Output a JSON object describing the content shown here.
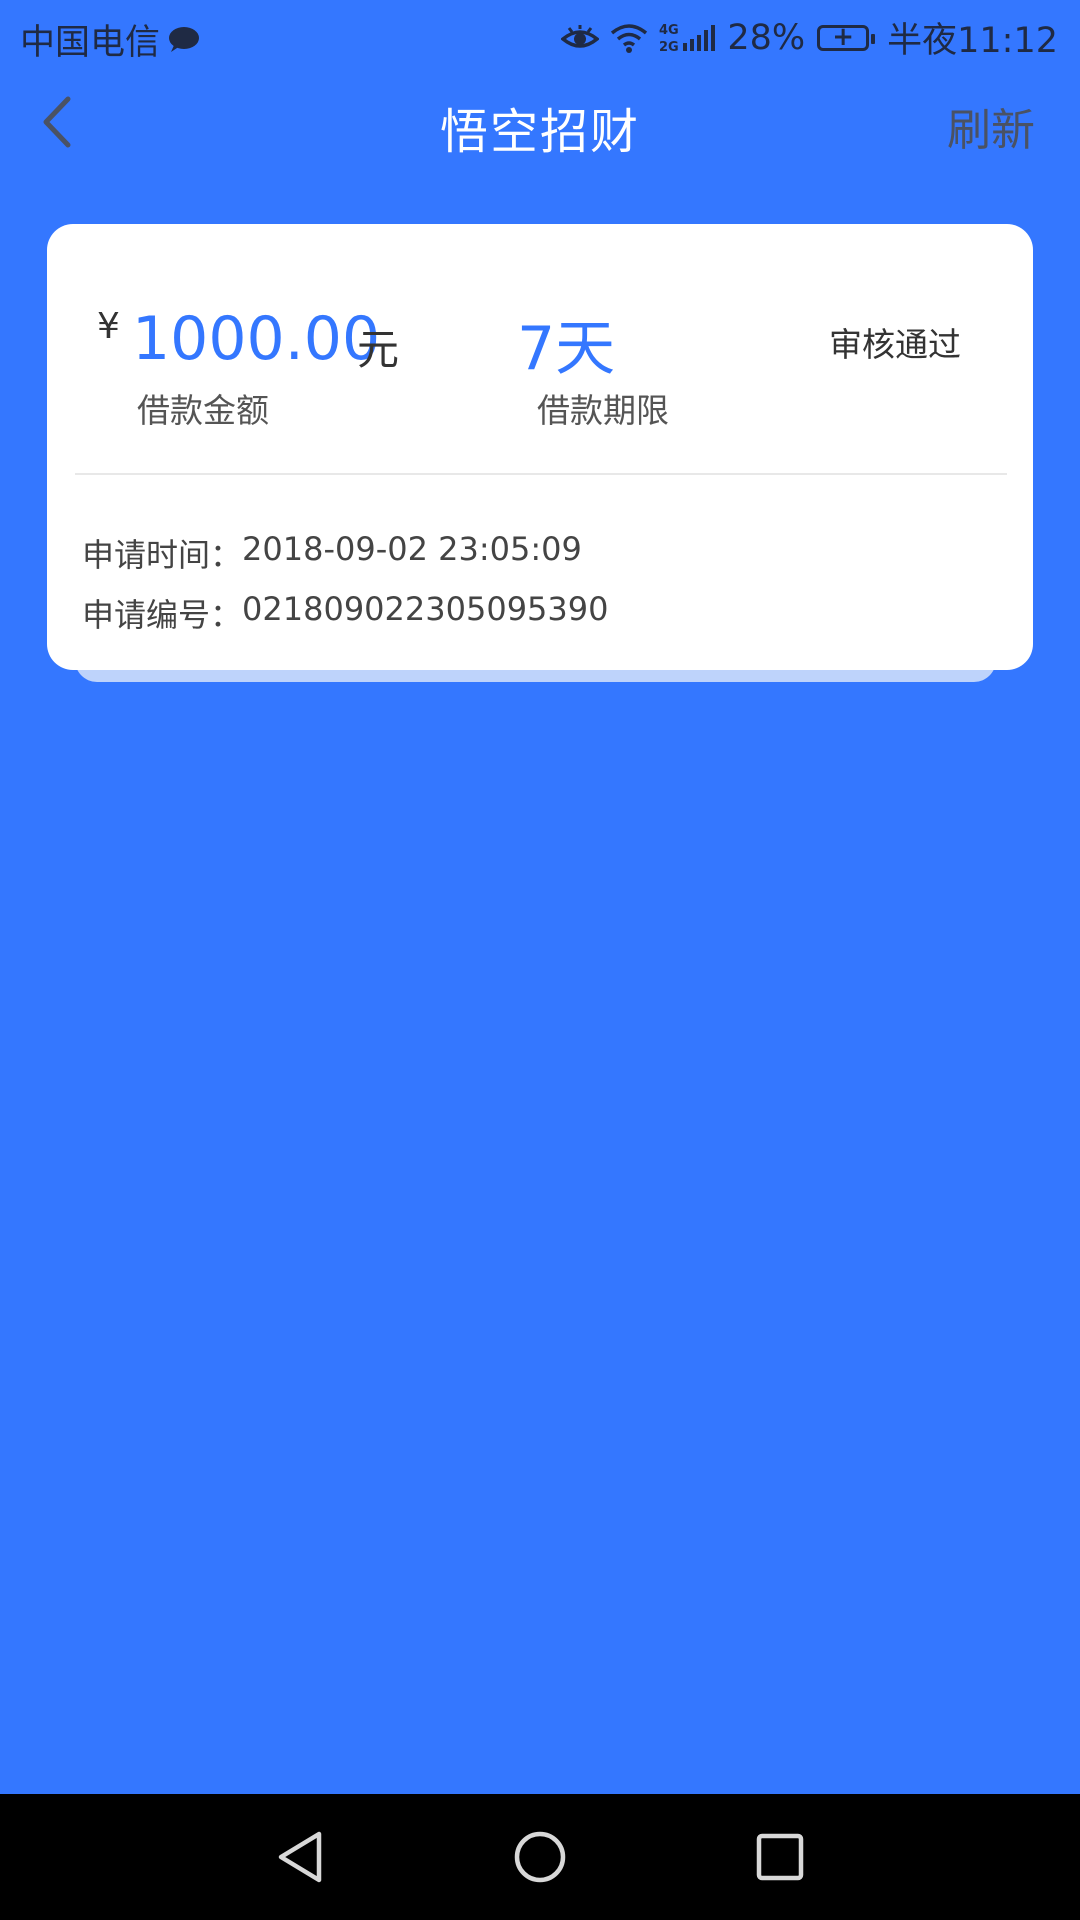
{
  "status_bar": {
    "carrier": "中国电信",
    "network": "4G 2G",
    "battery_percent": "28%",
    "time": "半夜11:12",
    "icons": [
      "chat-icon",
      "eye-icon",
      "wifi-icon",
      "signal-icon",
      "battery-icon"
    ]
  },
  "header": {
    "title": "悟空招财",
    "refresh_label": "刷新",
    "back_icon": "back-chevron-icon"
  },
  "loan_card": {
    "currency_symbol": "¥",
    "amount": "1000.00",
    "amount_unit": "元",
    "amount_label": "借款金额",
    "term": "7天",
    "term_label": "借款期限",
    "status": "审核通过",
    "apply_time_label": "申请时间：",
    "apply_time": "2018-09-02 23:05:09",
    "apply_number_label": "申请编号：",
    "apply_number": "021809022305095390"
  },
  "colors": {
    "background": "#3477FF",
    "accent": "#3477FF",
    "card": "#FFFFFF",
    "nav_bar": "#000000"
  },
  "system_nav": {
    "icons": [
      "back-triangle-icon",
      "home-circle-icon",
      "recents-square-icon"
    ]
  }
}
